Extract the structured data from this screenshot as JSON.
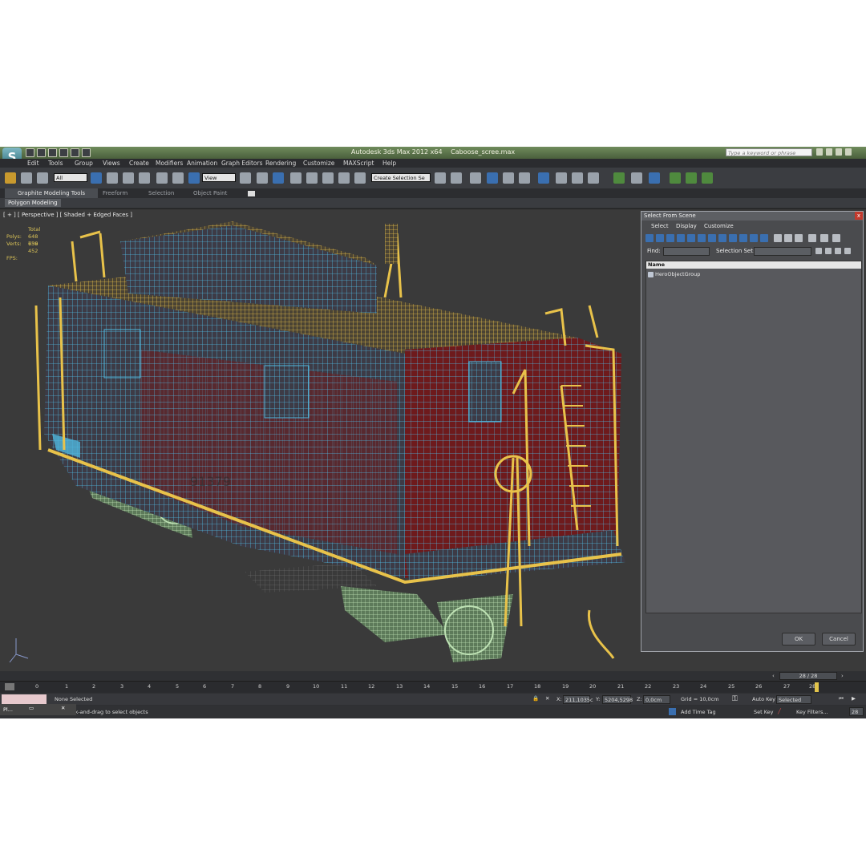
{
  "window": {
    "title_app": "Autodesk 3ds Max  2012 x64",
    "title_file": "Caboose_scree.max",
    "search_placeholder": "Type a keyword or phrase"
  },
  "menu": [
    "Edit",
    "Tools",
    "Group",
    "Views",
    "Create",
    "Modifiers",
    "Animation",
    "Graph Editors",
    "Rendering",
    "Customize",
    "MAXScript",
    "Help"
  ],
  "toolbar": {
    "filter_value": "All",
    "view_value": "View",
    "selection_set": "Create Selection Se"
  },
  "ribbon": {
    "tabs": [
      "Graphite Modeling Tools",
      "Freeform",
      "Selection",
      "Object Paint"
    ],
    "sub_tab": "Polygon Modeling"
  },
  "viewport": {
    "label": "[ + ] [ Perspective ] [ Shaded + Edged Faces ]",
    "stats_total": "Total",
    "polys_label": "Polys:",
    "polys_value": "648 736",
    "verts_label": "Verts:",
    "verts_value": "659 452",
    "fps_label": "FPS:",
    "car_number": "91379"
  },
  "dialog": {
    "title": "Select From Scene",
    "close": "x",
    "menu": [
      "Select",
      "Display",
      "Customize"
    ],
    "find_label": "Find:",
    "selset_label": "Selection Set:",
    "column_name": "Name",
    "items": [
      "HeroObjectGroup"
    ],
    "ok": "OK",
    "cancel": "Cancel"
  },
  "timeline": {
    "frame_display": "28 / 28",
    "ticks": [
      "0",
      "1",
      "2",
      "3",
      "4",
      "5",
      "6",
      "7",
      "8",
      "9",
      "10",
      "11",
      "12",
      "13",
      "14",
      "15",
      "16",
      "17",
      "18",
      "19",
      "20",
      "21",
      "22",
      "23",
      "24",
      "25",
      "26",
      "27",
      "28"
    ]
  },
  "status": {
    "selection": "None Selected",
    "prompt": "ck-and-drag to select objects",
    "x_label": "X:",
    "x_value": "211,1035c",
    "y_label": "Y:",
    "y_value": "5204,5298",
    "z_label": "Z:",
    "z_value": "0,0cm",
    "grid": "Grid = 10,0cm",
    "add_time_tag": "Add Time Tag",
    "auto_key": "Auto Key",
    "selected": "Selected",
    "set_key": "Set Key",
    "key_filters": "Key Filters...",
    "frame_field": "28",
    "task_label": "Pl..."
  },
  "colors": {
    "wire_yellow": "#e8c24a",
    "wire_cyan": "#4fb8df",
    "wire_red": "#6e1a1c",
    "wire_green": "#a8d6a0",
    "viewport_bg": "#3a3a3a"
  }
}
